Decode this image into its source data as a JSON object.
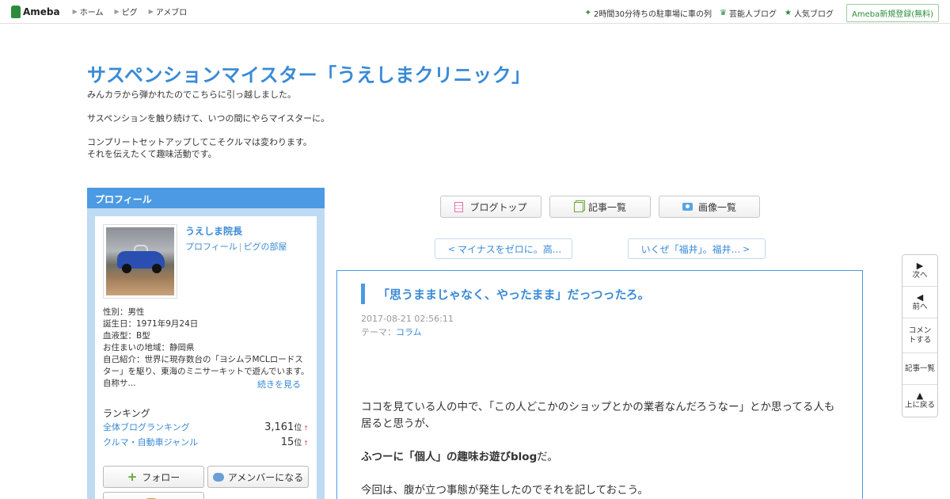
{
  "topbar": {
    "logo": "Ameba",
    "nav": [
      "ホーム",
      "ピグ",
      "アメブロ"
    ],
    "right": [
      {
        "icon": "sparkle-icon",
        "label": "2時間30分待ちの駐車場に車の列"
      },
      {
        "icon": "crown-icon",
        "label": "芸能人ブログ"
      },
      {
        "icon": "star-icon",
        "label": "人気ブログ"
      }
    ],
    "signup": "Ameba新規登録(無料)"
  },
  "header": {
    "title": "サスペンションマイスター「うえしまクリニック」",
    "desc": [
      "みんカラから弾かれたのでこちらに引っ越しました。",
      "サスペンションを触り続けて、いつの間にやらマイスターに。",
      "コンプリートセットアップしてこそクルマは変わります。",
      "それを伝えたくて趣味活動です。"
    ]
  },
  "profile": {
    "heading": "プロフィール",
    "name": "うえしま院長",
    "link_profile": "プロフィール",
    "link_pig": "ピグの部屋",
    "gender": "性別：男性",
    "birthday": "誕生日：1971年9月24日",
    "blood": "血液型：B型",
    "region": "お住まいの地域：静岡県",
    "intro": "自己紹介：世界に現存数台の「ヨシムラMCLロードスター」を駆り、東海のミニサーキットで遊んでいます。 自称サ...",
    "more": "続きを見る",
    "ranking_title": "ランキング",
    "rankings": [
      {
        "label": "全体ブログランキング",
        "value": "3,161",
        "unit": "位",
        "trend": "↑"
      },
      {
        "label": "クルマ・自動車ジャンル",
        "value": "15",
        "unit": "位",
        "trend": "↑"
      }
    ],
    "follow": "フォロー",
    "amember": "アメンバーになる"
  },
  "nav": {
    "blogtop": "ブログトップ",
    "entries": "記事一覧",
    "images": "画像一覧",
    "prev": "マイナスをゼロに。高...",
    "next": "いくぜ「福井」。福井..."
  },
  "article": {
    "title": "「思うままじゃなく、やったまま」だっつったろ。",
    "date": "2017-08-21 02:56:11",
    "theme_label": "テーマ：",
    "theme": "コラム",
    "p1": "ココを見ている人の中で、「この人どこかのショップとかの業者なんだろうなー」とか思ってる人も居ると思うが、",
    "p2_bold": "ふつーに「個人」の趣味お遊びblog",
    "p2_tail": "だ。",
    "p3": "今回は、腹が立つ事態が発生したのでそれを記しておこう。"
  },
  "floatnav": {
    "next": "次へ",
    "prev": "前へ",
    "comment": "コメントする",
    "list": "記事一覧",
    "top": "上に戻る"
  }
}
